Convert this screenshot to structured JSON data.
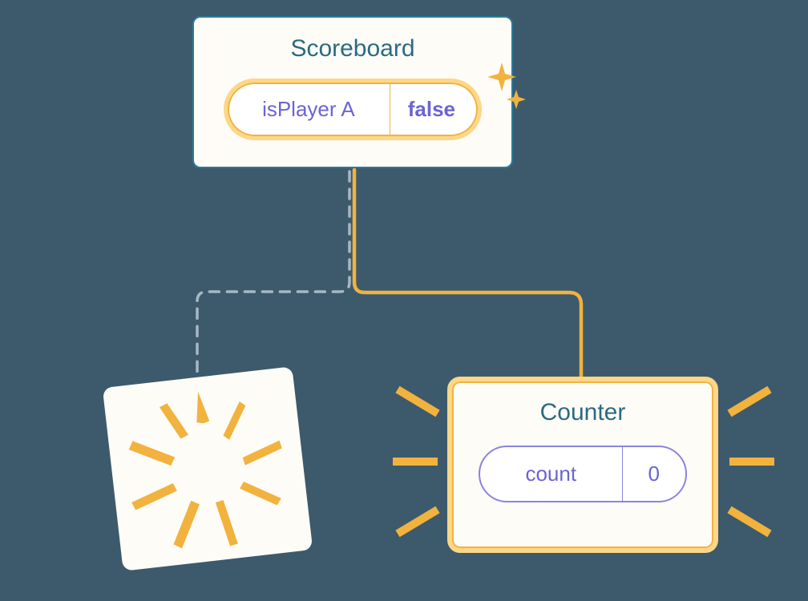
{
  "scoreboard": {
    "title": "Scoreboard",
    "prop_name": "isPlayer A",
    "prop_value": "false"
  },
  "counter": {
    "title": "Counter",
    "state_name": "count",
    "state_value": "0"
  },
  "colors": {
    "accent_orange": "#f2b23e",
    "accent_orange_light": "#fcd787",
    "teal": "#2b6a82",
    "purple": "#6c63d6",
    "page_bg": "#3d5a6c",
    "card_bg": "#fefcf7"
  }
}
